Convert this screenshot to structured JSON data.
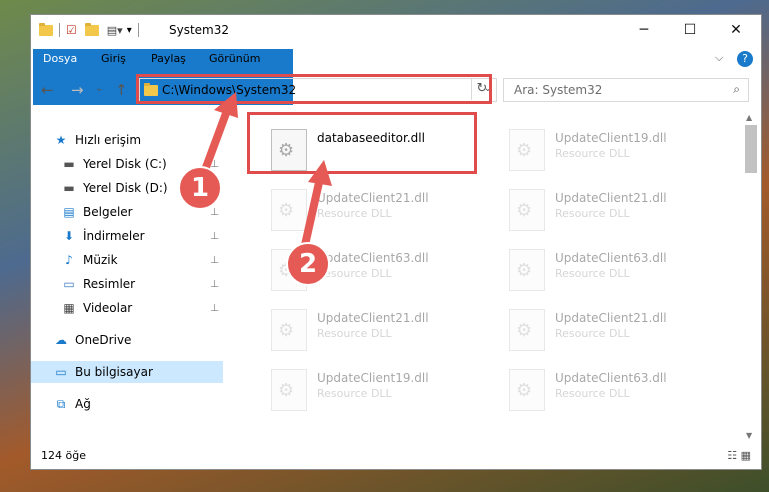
{
  "window": {
    "title": "System32",
    "controls": {
      "min": "─",
      "max": "☐",
      "close": "✕"
    }
  },
  "ribbon": {
    "tabs": [
      "Dosya",
      "Giriş",
      "Paylaş",
      "Görünüm"
    ],
    "expand": "⌵",
    "help": "?"
  },
  "nav": {
    "back": "←",
    "forward": "→",
    "recent": "⌄",
    "up": "↑",
    "address": "C:\\Windows\\System32",
    "refresh": "↻",
    "search_placeholder": "Ara: System32",
    "search_icon": "⌕"
  },
  "sidebar": {
    "items": [
      {
        "label": "Hızlı erişim",
        "icon": "★",
        "icon_color": "#1979ca",
        "pinned": false
      },
      {
        "label": "Yerel Disk (C:)",
        "icon": "▬",
        "icon_color": "#555555",
        "pinned": true
      },
      {
        "label": "Yerel Disk (D:)",
        "icon": "▬",
        "icon_color": "#555555",
        "pinned": true
      },
      {
        "label": "Belgeler",
        "icon": "▤",
        "icon_color": "#1979ca",
        "pinned": true
      },
      {
        "label": "İndirmeler",
        "icon": "⬇",
        "icon_color": "#1979ca",
        "pinned": true
      },
      {
        "label": "Müzik",
        "icon": "♪",
        "icon_color": "#1979ca",
        "pinned": true
      },
      {
        "label": "Resimler",
        "icon": "▭",
        "icon_color": "#3a7bbf",
        "pinned": true
      },
      {
        "label": "Videolar",
        "icon": "▦",
        "icon_color": "#444444",
        "pinned": true
      },
      {
        "label": "OneDrive",
        "icon": "☁",
        "icon_color": "#1979ca",
        "pinned": false
      },
      {
        "label": "Bu bilgisayar",
        "icon": "▭",
        "icon_color": "#1979ca",
        "pinned": false,
        "selected": true
      },
      {
        "label": "Ağ",
        "icon": "⧉",
        "icon_color": "#1979ca",
        "pinned": false
      }
    ],
    "pin_glyph": "📌"
  },
  "files": [
    {
      "name": "databaseeditor.dll",
      "type": "",
      "highlight": true
    },
    {
      "name": "UpdateClient19.dll",
      "type": "Resource DLL"
    },
    {
      "name": "UpdateClient21.dll",
      "type": "Resource DLL"
    },
    {
      "name": "UpdateClient21.dll",
      "type": "Resource DLL"
    },
    {
      "name": "UpdateClient63.dll",
      "type": "Resource DLL"
    },
    {
      "name": "UpdateClient63.dll",
      "type": "Resource DLL"
    },
    {
      "name": "UpdateClient21.dll",
      "type": "Resource DLL"
    },
    {
      "name": "UpdateClient21.dll",
      "type": "Resource DLL"
    },
    {
      "name": "UpdateClient19.dll",
      "type": "Resource DLL"
    },
    {
      "name": "UpdateClient63.dll",
      "type": "Resource DLL"
    }
  ],
  "status": {
    "count": "124 öğe"
  },
  "annotations": {
    "step1": "1",
    "step2": "2"
  },
  "colors": {
    "accent": "#1979ca",
    "highlight": "#e04b4b"
  }
}
